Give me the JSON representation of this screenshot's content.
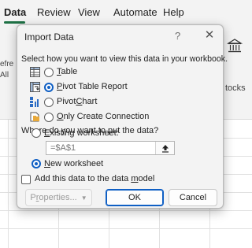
{
  "menubar": {
    "tabs": [
      {
        "label": "Data",
        "active": true
      },
      {
        "label": "Review"
      },
      {
        "label": "View"
      },
      {
        "label": "Automate"
      },
      {
        "label": "Help"
      }
    ]
  },
  "ribbon": {
    "left_fragment_1": "efre",
    "left_fragment_2": "All",
    "right_fragment_1": "tocks",
    "right_fragment_2": "es"
  },
  "dialog": {
    "title": "Import Data",
    "help": "?",
    "close": "✕",
    "view_prompt": "Select how you want to view this data in your workbook.",
    "view_options": [
      {
        "pre": "",
        "u": "T",
        "post": "able",
        "selected": false,
        "icon": "table-icon"
      },
      {
        "pre": "",
        "u": "P",
        "post": "ivot Table Report",
        "selected": true,
        "icon": "pivot-table-icon"
      },
      {
        "pre": "Pivot",
        "u": "C",
        "post": "hart",
        "selected": false,
        "icon": "pivot-chart-icon"
      },
      {
        "pre": "",
        "u": "O",
        "post": "nly Create Connection",
        "selected": false,
        "icon": "connection-icon"
      }
    ],
    "location_prompt": "Where do you want to put the data?",
    "existing_ws": {
      "pre": "",
      "u": "E",
      "post": "xisting worksheet:",
      "selected": false
    },
    "cell_ref": "=$A$1",
    "new_ws": {
      "pre": "",
      "u": "N",
      "post": "ew worksheet",
      "selected": true
    },
    "data_model": {
      "pre": "Add this data to the data ",
      "u": "m",
      "post": "odel",
      "checked": false
    },
    "buttons": {
      "properties": {
        "pre": "P",
        "u": "r",
        "post": "operties..."
      },
      "ok": "OK",
      "cancel": "Cancel"
    }
  },
  "colors": {
    "accent": "#0f5fc4",
    "excel_green": "#1e7145"
  }
}
